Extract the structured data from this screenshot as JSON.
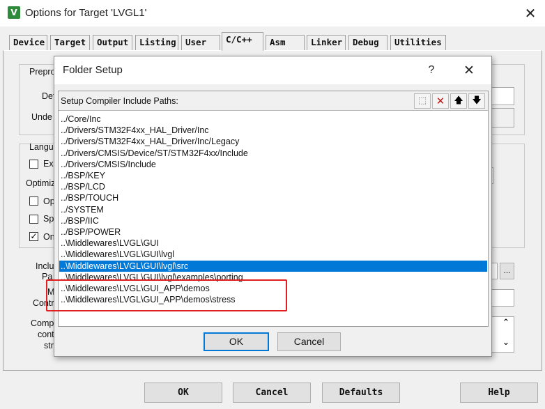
{
  "window": {
    "title": "Options for Target 'LVGL1'",
    "icon": "keil-uvision-icon",
    "close_glyph": "✕"
  },
  "tabs": [
    {
      "label": "Device"
    },
    {
      "label": "Target"
    },
    {
      "label": "Output"
    },
    {
      "label": "Listing"
    },
    {
      "label": "User"
    },
    {
      "label": "C/C++",
      "active": true
    },
    {
      "label": "Asm"
    },
    {
      "label": "Linker"
    },
    {
      "label": "Debug"
    },
    {
      "label": "Utilities"
    }
  ],
  "background": {
    "preproc_label": "Prepro",
    "define_label": "Def",
    "undefine_label": "Unde",
    "language_label": "Langu",
    "ex_label": "Ex",
    "optimize_label": "Optimiz",
    "op_label": "Op",
    "sp_label": "Sp",
    "on_label": "On",
    "include_label_1": "Inclu",
    "include_label_2": "Pa",
    "misc_label_1": "Mi",
    "misc_label_2": "Contro",
    "compiler_label_1": "Comp",
    "compiler_label_2": "cont",
    "compiler_label_3": "stri",
    "browse_glyph": "...",
    "scroll_up": "⌃",
    "scroll_down": "⌄"
  },
  "bottom_buttons": {
    "ok": "OK",
    "cancel": "Cancel",
    "defaults": "Defaults",
    "help": "Help"
  },
  "dialog": {
    "title": "Folder Setup",
    "help_glyph": "?",
    "close_glyph": "✕",
    "list_header": "Setup Compiler Include Paths:",
    "toolbar": {
      "new_glyph": "⬚",
      "delete_glyph": "✕",
      "up_glyph": "🡅",
      "down_glyph": "🡇"
    },
    "paths": [
      "../Core/Inc",
      "../Drivers/STM32F4xx_HAL_Driver/Inc",
      "../Drivers/STM32F4xx_HAL_Driver/Inc/Legacy",
      "../Drivers/CMSIS/Device/ST/STM32F4xx/Include",
      "../Drivers/CMSIS/Include",
      "../BSP/KEY",
      "../BSP/LCD",
      "../BSP/TOUCH",
      "../SYSTEM",
      "../BSP/IIC",
      "../BSP/POWER",
      "..\\Middlewares\\LVGL\\GUI",
      "..\\Middlewares\\LVGL\\GUI\\lvgl",
      "..\\Middlewares\\LVGL\\GUI\\lvgl\\src",
      "..\\Middlewares\\LVGL\\GUI\\lvgl\\examples\\porting",
      "..\\Middlewares\\LVGL\\GUI_APP\\demos",
      "..\\Middlewares\\LVGL\\GUI_APP\\demos\\stress"
    ],
    "selected_index": 13,
    "ok": "OK",
    "cancel": "Cancel"
  },
  "colors": {
    "selection": "#0078d7",
    "highlight_box": "#e02020"
  }
}
